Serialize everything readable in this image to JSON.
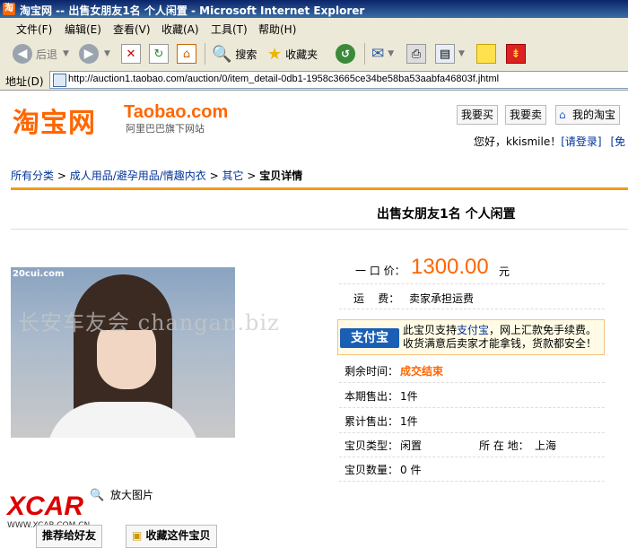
{
  "window": {
    "title": "淘宝网 -- 出售女朋友1名 个人闲置 - Microsoft Internet Explorer"
  },
  "menu": [
    "文件(F)",
    "编辑(E)",
    "查看(V)",
    "收藏(A)",
    "工具(T)",
    "帮助(H)"
  ],
  "toolbar": {
    "back": "后退",
    "search": "搜索",
    "favorites": "收藏夹"
  },
  "address": {
    "label": "地址(D)",
    "url": "http://auction1.taobao.com/auction/0/item_detail-0db1-1958c3665ce34be58ba53aabfa46803f.jhtml"
  },
  "logo": {
    "cn": "淘宝网",
    "en": "Taobao.com",
    "sub": "阿里巴巴旗下网站"
  },
  "topnav": {
    "buy": "我要买",
    "sell": "我要卖",
    "my": "我的淘宝"
  },
  "greeting": {
    "prefix": "您好，kkismile！",
    "login": "[请登录]",
    "free": "[免"
  },
  "breadcrumb": {
    "c1": "所有分类",
    "c2": "成人用品/避孕用品/情趣内衣",
    "c3": "其它",
    "current": "宝贝详情",
    "sep": " > "
  },
  "item": {
    "title": "出售女朋友1名  个人闲置",
    "price_label": "一 口 价：",
    "price": "1300.00",
    "price_unit": "元",
    "shipping_label": "运    费：",
    "shipping": "卖家承担运费",
    "alipay_logo": "支付宝",
    "alipay_l1_a": "此宝贝支持",
    "alipay_l1_link": "支付宝",
    "alipay_l1_b": "，网上汇款免手续费。",
    "alipay_l2": "收货满意后卖家才能拿钱，货款都安全！",
    "remaining_label": "剩余时间：",
    "remaining": "成交结束",
    "period_sold_label": "本期售出：",
    "period_sold": "1件",
    "total_sold_label": "累计售出：",
    "total_sold": "1件",
    "type_label": "宝贝类型：",
    "type": "闲置",
    "location_label": "所 在 地：",
    "location": "上海",
    "qty_label": "宝贝数量：",
    "qty": "0 件"
  },
  "photo": {
    "watermark": "20cui.com",
    "enlarge": "放大图片"
  },
  "overlay_watermark": "长安车友会 changan.biz",
  "footer": {
    "xcar": "XCAR",
    "xcar_url": "WWW.XCAR.COM.CN",
    "recommend": "推荐给好友",
    "collect": "收藏这件宝贝"
  },
  "colors": {
    "accent": "#f60",
    "link": "#039",
    "orange_line": "#f29a1e"
  }
}
